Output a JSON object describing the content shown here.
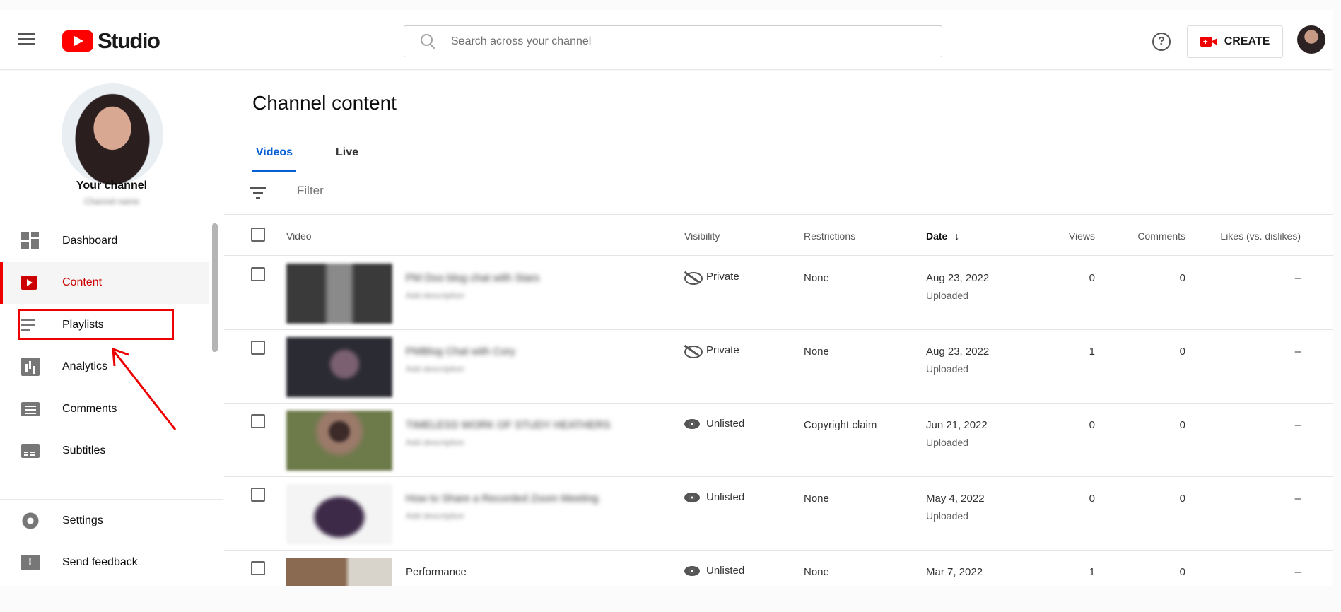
{
  "app": {
    "logo_text": "Studio"
  },
  "header": {
    "search_placeholder": "Search across your channel",
    "create_label": "CREATE",
    "help_glyph": "?"
  },
  "sidebar": {
    "your_channel": "Your channel",
    "channel_name": "Channel name",
    "items": [
      {
        "label": "Dashboard",
        "icon": "dashboard-icon"
      },
      {
        "label": "Content",
        "icon": "content-icon",
        "active": true
      },
      {
        "label": "Playlists",
        "icon": "playlists-icon"
      },
      {
        "label": "Analytics",
        "icon": "analytics-icon"
      },
      {
        "label": "Comments",
        "icon": "comments-icon"
      },
      {
        "label": "Subtitles",
        "icon": "subtitles-icon"
      }
    ],
    "bottom_items": [
      {
        "label": "Settings",
        "icon": "settings-icon"
      },
      {
        "label": "Send feedback",
        "icon": "feedback-icon"
      }
    ]
  },
  "main": {
    "title": "Channel content",
    "tabs": [
      {
        "label": "Videos",
        "active": true
      },
      {
        "label": "Live"
      }
    ],
    "filter_placeholder": "Filter",
    "columns": {
      "video": "Video",
      "visibility": "Visibility",
      "restrictions": "Restrictions",
      "date": "Date",
      "date_sort_glyph": "↓",
      "views": "Views",
      "comments": "Comments",
      "likes": "Likes (vs. dislikes)"
    },
    "rows": [
      {
        "title": "PM Doo blog chat with Stars",
        "description": "Add description",
        "visibility": "Private",
        "visibility_icon": "eye-off-icon",
        "restrictions": "None",
        "date": "Aug 23, 2022",
        "status": "Uploaded",
        "views": "0",
        "comments": "0",
        "likes": "–"
      },
      {
        "title": "PMBlog Chat with Cory",
        "description": "Add description",
        "visibility": "Private",
        "visibility_icon": "eye-off-icon",
        "restrictions": "None",
        "date": "Aug 23, 2022",
        "status": "Uploaded",
        "views": "1",
        "comments": "0",
        "likes": "–"
      },
      {
        "title": "TIMELESS WORK OF STUDY HEATHERS",
        "description": "Add description",
        "visibility": "Unlisted",
        "visibility_icon": "eye-icon",
        "restrictions": "Copyright claim",
        "date": "Jun 21, 2022",
        "status": "Uploaded",
        "views": "0",
        "comments": "0",
        "likes": "–"
      },
      {
        "title": "How to Share a Recorded Zoom Meeting",
        "description": "Add description",
        "visibility": "Unlisted",
        "visibility_icon": "eye-icon",
        "restrictions": "None",
        "date": "May 4, 2022",
        "status": "Uploaded",
        "views": "0",
        "comments": "0",
        "likes": "–"
      },
      {
        "title": "Performance",
        "description": "",
        "visibility": "Unlisted",
        "visibility_icon": "eye-icon",
        "restrictions": "None",
        "date": "Mar 7, 2022",
        "status": "",
        "views": "1",
        "comments": "0",
        "likes": "–"
      }
    ]
  },
  "colors": {
    "brand_red": "#ff0000",
    "accent_blue": "#065fd4",
    "annotation_red": "#e00000"
  }
}
